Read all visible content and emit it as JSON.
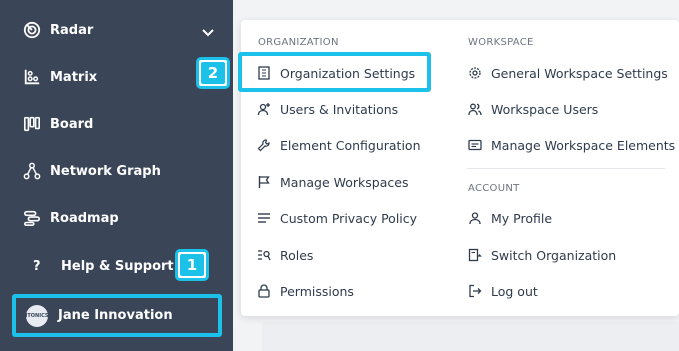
{
  "sidebar": {
    "items": [
      {
        "label": "Radar",
        "icon": "radar-icon"
      },
      {
        "label": "Matrix",
        "icon": "matrix-icon"
      },
      {
        "label": "Board",
        "icon": "board-icon"
      },
      {
        "label": "Network Graph",
        "icon": "network-graph-icon"
      },
      {
        "label": "Roadmap",
        "icon": "roadmap-icon"
      }
    ],
    "help_label": "Help & Support",
    "help_icon": "?",
    "user": {
      "name": "Jane Innovation",
      "avatar_text": "ITONICS"
    }
  },
  "badges": {
    "one": "1",
    "two": "2"
  },
  "menu": {
    "organization_title": "ORGANIZATION",
    "workspace_title": "WORKSPACE",
    "account_title": "ACCOUNT",
    "organization_items": [
      {
        "label": "Organization Settings",
        "icon": "building-icon"
      },
      {
        "label": "Users & Invitations",
        "icon": "user-plus-icon"
      },
      {
        "label": "Element Configuration",
        "icon": "wrench-icon"
      },
      {
        "label": "Manage Workspaces",
        "icon": "flag-icon"
      },
      {
        "label": "Custom Privacy Policy",
        "icon": "lines-icon"
      },
      {
        "label": "Roles",
        "icon": "roles-icon"
      },
      {
        "label": "Permissions",
        "icon": "lock-icon"
      }
    ],
    "workspace_items": [
      {
        "label": "General Workspace Settings",
        "icon": "gear-icon"
      },
      {
        "label": "Workspace Users",
        "icon": "users-icon"
      },
      {
        "label": "Manage Workspace Elements",
        "icon": "card-icon"
      }
    ],
    "account_items": [
      {
        "label": "My Profile",
        "icon": "user-icon"
      },
      {
        "label": "Switch Organization",
        "icon": "switch-icon"
      },
      {
        "label": "Log out",
        "icon": "logout-icon"
      }
    ]
  },
  "colors": {
    "sidebar_bg": "#3a4557",
    "highlight": "#1cc1ea",
    "menu_text": "#2f3b4c"
  }
}
